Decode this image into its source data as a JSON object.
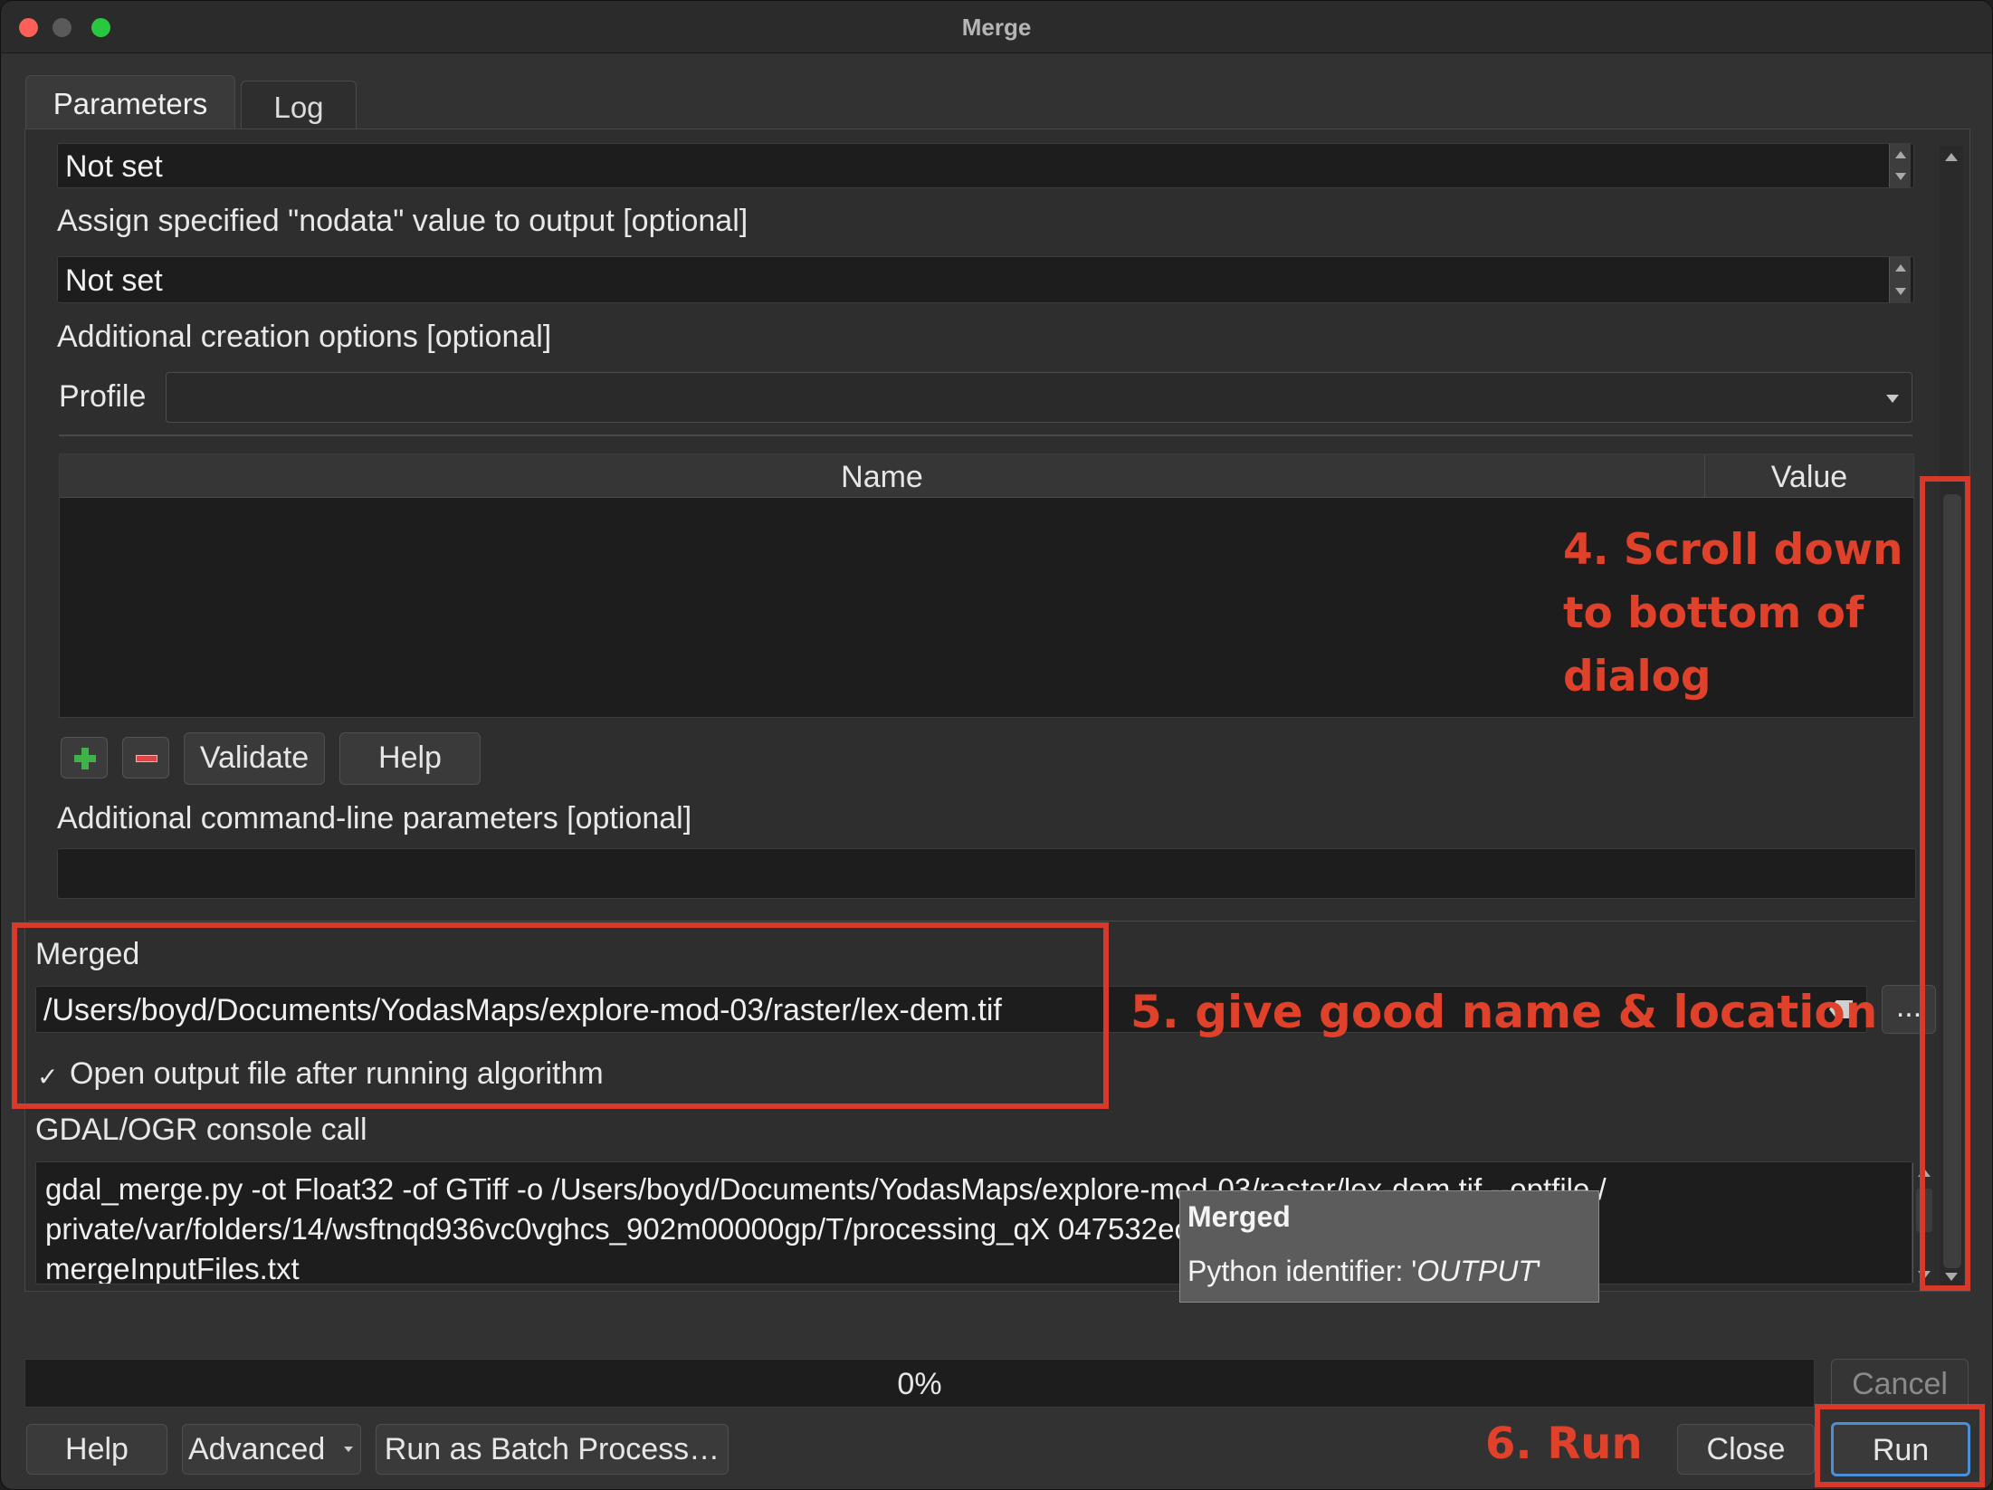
{
  "window": {
    "title": "Merge"
  },
  "tabs": {
    "parameters": "Parameters",
    "log": "Log"
  },
  "params": {
    "top_field_value": "Not set",
    "nodata_label": "Assign specified \"nodata\" value to output [optional]",
    "nodata_value": "Not set",
    "creation_options_label": "Additional creation options [optional]",
    "profile_label": "Profile",
    "profile_value": "",
    "table_headers": {
      "name": "Name",
      "value": "Value"
    },
    "validate_label": "Validate",
    "help_inline_label": "Help",
    "cmdline_label": "Additional command-line parameters [optional]",
    "cmdline_value": "",
    "merged_label": "Merged",
    "merged_path": "/Users/boyd/Documents/YodasMaps/explore-mod-03/raster/lex-dem.tif",
    "browse_label": "...",
    "open_output_checkmark": "✓",
    "open_output_label": "Open output file after running algorithm",
    "console_label": "GDAL/OGR console call",
    "console_line1": "gdal_merge.py -ot Float32 -of GTiff -o /Users/boyd/Documents/YodasMaps/explore-mod-03/raster/lex-dem.tif --optfile /",
    "console_line2": "private/var/folders/14/wsftnqd936vc0vghcs_902m00000gp/T/processing_qX                                     047532ecb02d2e8/",
    "console_line3": "mergeInputFiles.txt"
  },
  "tooltip": {
    "title": "Merged",
    "body_prefix": "Python identifier: '",
    "body_identifier": "OUTPUT",
    "body_suffix": "'"
  },
  "progress": {
    "text": "0%"
  },
  "buttons": {
    "cancel": "Cancel",
    "help": "Help",
    "advanced": "Advanced",
    "batch": "Run as Batch Process…",
    "close": "Close",
    "run": "Run"
  },
  "annotations": {
    "step4_line1": "4. Scroll down",
    "step4_line2": "to bottom of",
    "step4_line3": "dialog",
    "step5": "5. give good name & location",
    "step6": "6. Run"
  },
  "colors": {
    "annotation": "#d73a2a",
    "run_button_border": "#4a90d9",
    "add_icon": "#3fb24a",
    "remove_icon": "#e04444"
  },
  "icons": [
    "close-window",
    "minimize-window",
    "maximize-window",
    "add-row-icon",
    "remove-row-icon",
    "clear-input-icon",
    "dropdown-arrow-icon"
  ]
}
